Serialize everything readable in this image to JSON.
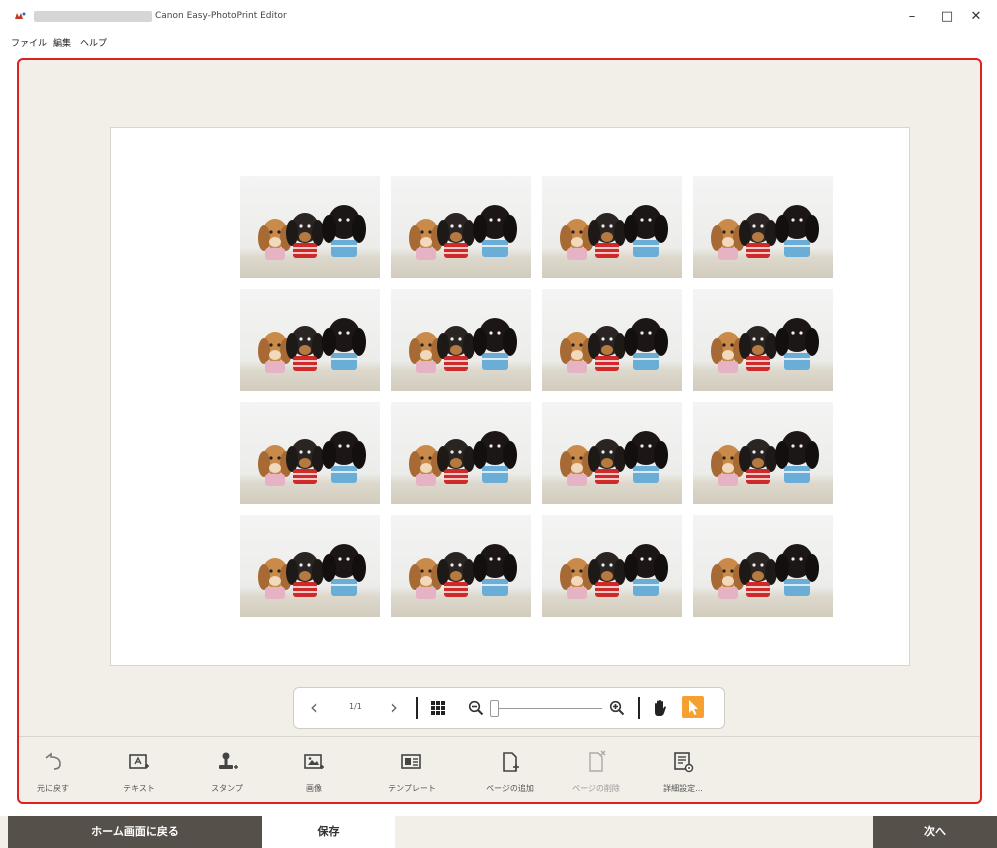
{
  "window": {
    "title": "Canon Easy-PhotoPrint Editor",
    "minimize_glyph": "–",
    "maximize_glyph": "□",
    "close_glyph": "✕"
  },
  "menu": {
    "file": "ファイル",
    "edit": "編集",
    "help": "ヘルプ"
  },
  "layout": {
    "rows": 4,
    "columns": 4,
    "photo_count": 16
  },
  "viewer": {
    "page_indicator": "1/1",
    "prev_glyph": "‹",
    "next_glyph": "›",
    "zoom_level": 0.0
  },
  "actions": [
    {
      "label": "元に戻す",
      "icon": "undo-icon",
      "enabled": true
    },
    {
      "label": "テキスト",
      "icon": "text-icon",
      "enabled": true
    },
    {
      "label": "スタンプ",
      "icon": "stamp-icon",
      "enabled": true
    },
    {
      "label": "画像",
      "icon": "image-icon",
      "enabled": true
    },
    {
      "label": "テンプレート",
      "icon": "template-icon",
      "enabled": true
    },
    {
      "label": "ページの追加",
      "icon": "add-page-icon",
      "enabled": true
    },
    {
      "label": "ページの削除",
      "icon": "delete-page-icon",
      "enabled": false
    },
    {
      "label": "詳細設定...",
      "icon": "advanced-settings-icon",
      "enabled": true
    }
  ],
  "footer": {
    "home": "ホーム画面に戻る",
    "save": "保存",
    "next": "次へ"
  },
  "colors": {
    "highlight_border": "#e02020",
    "select_tool": "#f5a030",
    "footer_dark": "#555049",
    "workspace_bg": "#f2eee8"
  }
}
